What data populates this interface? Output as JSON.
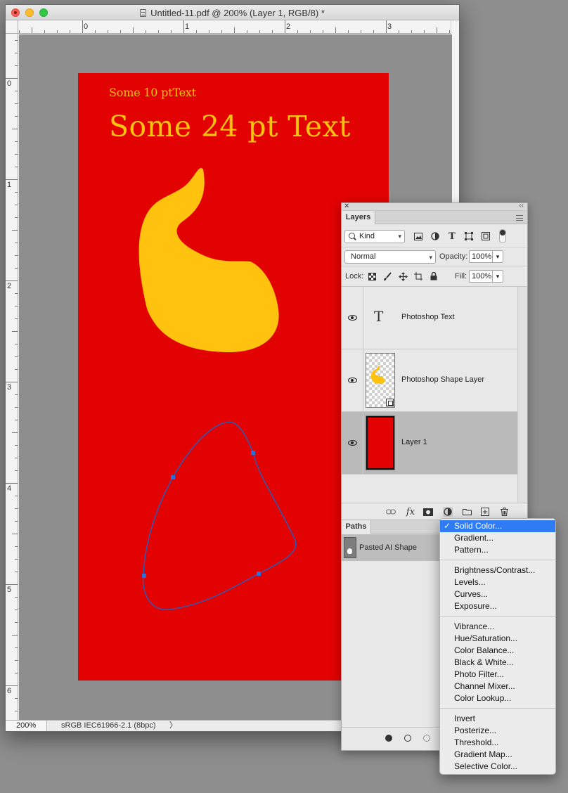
{
  "window": {
    "title": "Untitled-11.pdf @ 200% (Layer 1, RGB/8) *"
  },
  "rulers": {
    "horizontal": [
      "0",
      "1",
      "2",
      "3"
    ],
    "vertical": [
      "0",
      "1",
      "2",
      "3",
      "4",
      "5",
      "6"
    ]
  },
  "document": {
    "text_small": "Some 10 ptText",
    "text_large": "Some 24 pt Text",
    "canvas_color": "#e30202",
    "shape_color": "#ffc20e"
  },
  "statusbar": {
    "zoom": "200%",
    "profile": "sRGB IEC61966-2.1 (8bpc)",
    "arrow": "〉"
  },
  "layers_panel": {
    "tab": "Layers",
    "filter_kind": "Kind",
    "blend_mode": "Normal",
    "opacity_label": "Opacity:",
    "opacity_value": "100%",
    "lock_label": "Lock:",
    "fill_label": "Fill:",
    "fill_value": "100%",
    "layers": [
      {
        "name": "Photoshop Text",
        "type": "text",
        "glyph": "T",
        "visible": true,
        "selected": false
      },
      {
        "name": "Photoshop Shape Layer",
        "type": "shape",
        "visible": true,
        "selected": false
      },
      {
        "name": "Layer 1",
        "type": "pixel",
        "visible": true,
        "selected": true
      }
    ],
    "footer_icons": [
      "link-icon",
      "fx-icon",
      "mask-icon",
      "adjustment-icon",
      "folder-icon",
      "new-layer-icon",
      "trash-icon"
    ],
    "fx_label": "fx"
  },
  "paths_panel": {
    "tab": "Paths",
    "paths": [
      {
        "name": "Pasted AI Shape"
      }
    ]
  },
  "adjustment_menu": {
    "groups": [
      [
        {
          "label": "Solid Color...",
          "checked": true,
          "highlighted": true
        },
        {
          "label": "Gradient...",
          "checked": false,
          "highlighted": false
        },
        {
          "label": "Pattern...",
          "checked": false,
          "highlighted": false
        }
      ],
      [
        {
          "label": "Brightness/Contrast...",
          "checked": false,
          "highlighted": false
        },
        {
          "label": "Levels...",
          "checked": false,
          "highlighted": false
        },
        {
          "label": "Curves...",
          "checked": false,
          "highlighted": false
        },
        {
          "label": "Exposure...",
          "checked": false,
          "highlighted": false
        }
      ],
      [
        {
          "label": "Vibrance...",
          "checked": false,
          "highlighted": false
        },
        {
          "label": "Hue/Saturation...",
          "checked": false,
          "highlighted": false
        },
        {
          "label": "Color Balance...",
          "checked": false,
          "highlighted": false
        },
        {
          "label": "Black & White...",
          "checked": false,
          "highlighted": false
        },
        {
          "label": "Photo Filter...",
          "checked": false,
          "highlighted": false
        },
        {
          "label": "Channel Mixer...",
          "checked": false,
          "highlighted": false
        },
        {
          "label": "Color Lookup...",
          "checked": false,
          "highlighted": false
        }
      ],
      [
        {
          "label": "Invert",
          "checked": false,
          "highlighted": false
        },
        {
          "label": "Posterize...",
          "checked": false,
          "highlighted": false
        },
        {
          "label": "Threshold...",
          "checked": false,
          "highlighted": false
        },
        {
          "label": "Gradient Map...",
          "checked": false,
          "highlighted": false
        },
        {
          "label": "Selective Color...",
          "checked": false,
          "highlighted": false
        }
      ]
    ],
    "check_glyph": "✓"
  }
}
